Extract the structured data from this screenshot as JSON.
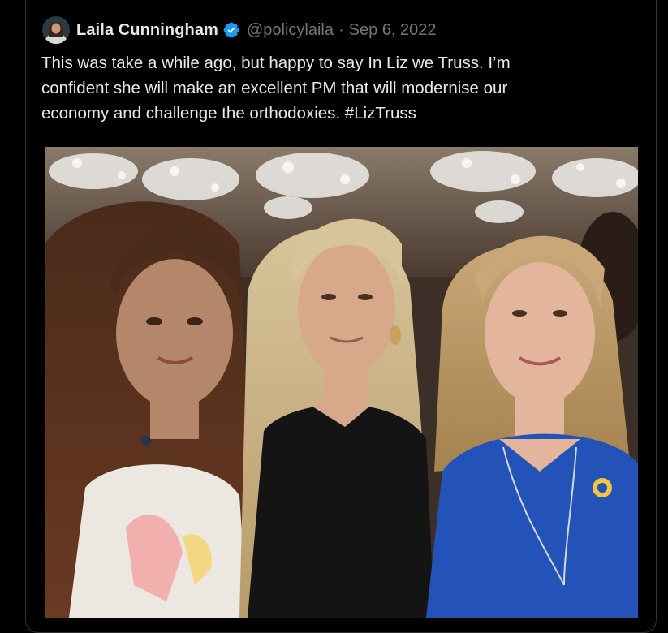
{
  "tweet": {
    "display_name": "Laila Cunningham",
    "handle": "@policylaila",
    "separator": "·",
    "date": "Sep 6, 2022",
    "text": "This was take a while ago, but happy to say In Liz we Truss. I’m\nconfident she will make an excellent PM that will modernise our\neconomy and challenge the orthodoxies. #LizTruss",
    "verified_color": "#1d9bf0"
  },
  "colors": {
    "background": "#000000",
    "text": "#e7e9ea",
    "muted": "#71767b",
    "border": "#2f3336"
  }
}
